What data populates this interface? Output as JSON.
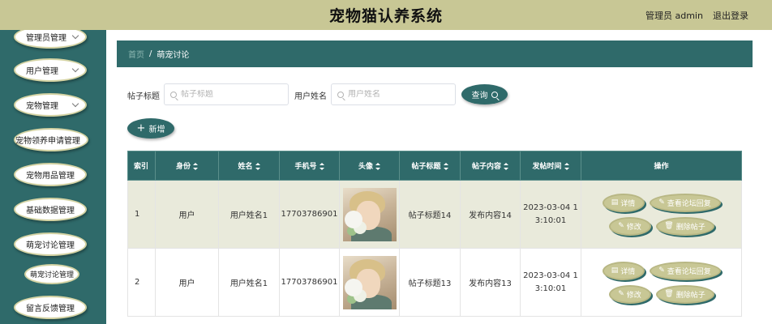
{
  "header": {
    "title": "宠物猫认养系统",
    "user": "管理员 admin",
    "logout": "退出登录"
  },
  "sidebar": {
    "items": [
      {
        "label": "管理员管理",
        "has_chevron": true
      },
      {
        "label": "用户管理",
        "has_chevron": true
      },
      {
        "label": "宠物管理",
        "has_chevron": true
      },
      {
        "label": "宠物领养申请管理",
        "has_chevron": false
      },
      {
        "label": "宠物用品管理",
        "has_chevron": false
      },
      {
        "label": "基础数据管理",
        "has_chevron": false
      },
      {
        "label": "萌宠讨论管理",
        "has_chevron": false
      },
      {
        "label": "留言反馈管理",
        "has_chevron": false
      }
    ],
    "subitem": "萌宠讨论管理"
  },
  "breadcrumb": {
    "home": "首页",
    "separator": "/",
    "current": "萌宠讨论"
  },
  "search": {
    "title_label": "帖子标题",
    "title_placeholder": "帖子标题",
    "name_label": "用户姓名",
    "name_placeholder": "用户姓名",
    "query_button": "查询"
  },
  "add_button": "新增",
  "table": {
    "columns": [
      "索引",
      "身份",
      "姓名",
      "手机号",
      "头像",
      "帖子标题",
      "帖子内容",
      "发帖时间",
      "操作"
    ],
    "rows": [
      {
        "index": "1",
        "role": "用户",
        "name": "用户姓名1",
        "phone": "17703786901",
        "title": "帖子标题14",
        "content": "发布内容14",
        "time_line1": "2023-03-04 1",
        "time_line2": "3:10:01"
      },
      {
        "index": "2",
        "role": "用户",
        "name": "用户姓名1",
        "phone": "17703786901",
        "title": "帖子标题13",
        "content": "发布内容13",
        "time_line1": "2023-03-04 1",
        "time_line2": "3:10:01"
      }
    ],
    "actions": {
      "detail": "详情",
      "view_replies": "查看论坛回复",
      "edit": "修改",
      "delete": "删除帖子"
    }
  },
  "colors": {
    "primary": "#2f6a6a",
    "accent": "#c8c795",
    "row_highlight": "#e9eadb"
  }
}
